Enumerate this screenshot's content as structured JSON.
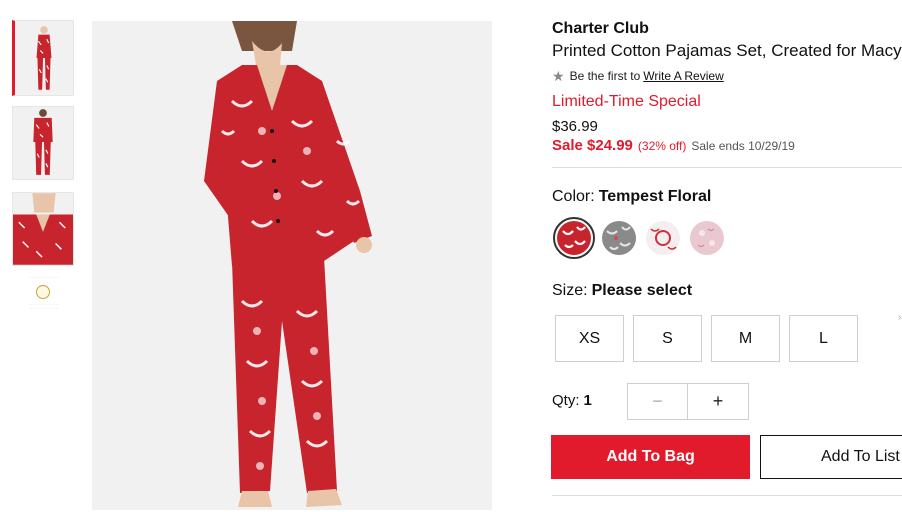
{
  "thumbnails": [
    {
      "name": "full-length-front",
      "active": true
    },
    {
      "name": "back-view",
      "active": false
    },
    {
      "name": "close-up-detail",
      "active": false
    }
  ],
  "product": {
    "brand": "Charter Club",
    "name": "Printed Cotton Pajamas Set, Created for Macy's",
    "review_prompt": "Be the first to",
    "review_link": "Write A Review",
    "promo": "Limited-Time Special",
    "original_price": "$36.99",
    "sale_price": "Sale $24.99",
    "discount": "(32% off)",
    "sale_ends": "Sale ends 10/29/19"
  },
  "color": {
    "label": "Color:",
    "selected": "Tempest Floral",
    "swatches": [
      {
        "name": "Tempest Floral",
        "selected": true,
        "base": "#c8242e"
      },
      {
        "name": "gray-floral",
        "selected": false,
        "base": "#8a8a8a"
      },
      {
        "name": "white-red-floral",
        "selected": false,
        "base": "#f4eeee"
      },
      {
        "name": "pink-print",
        "selected": false,
        "base": "#e9c9cf"
      }
    ]
  },
  "size": {
    "label": "Size:",
    "selected": "Please select",
    "options": [
      "XS",
      "S",
      "M",
      "L"
    ]
  },
  "quantity": {
    "label": "Qty:",
    "value": "1",
    "minus": "−",
    "plus": "+"
  },
  "actions": {
    "add_to_bag": "Add To Bag",
    "add_to_list": "Add To List"
  },
  "colors": {
    "accent_red": "#e11a2c",
    "border_gray": "#cfcfcf"
  }
}
